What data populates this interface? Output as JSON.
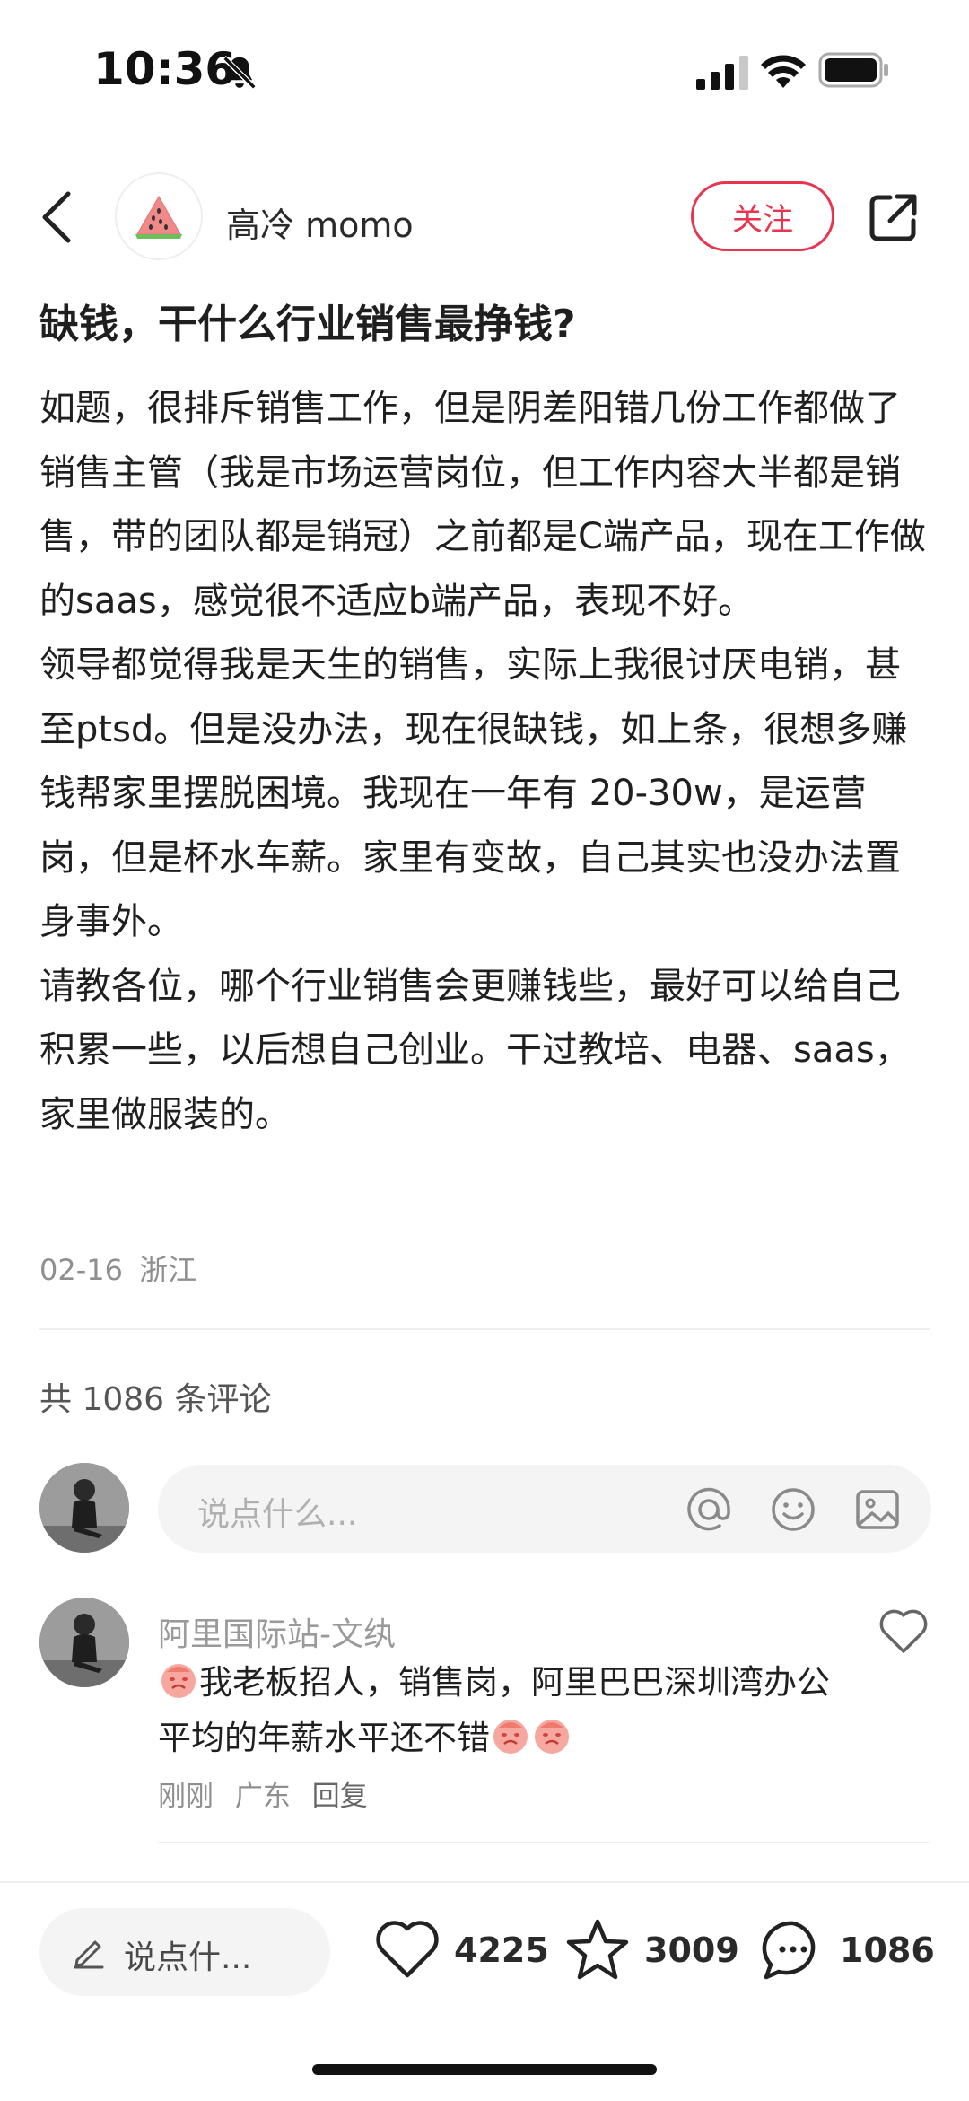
{
  "status_bar": {
    "time": "10:36"
  },
  "header": {
    "author": "高冷 momo",
    "follow_label": "关注"
  },
  "post": {
    "title": "缺钱，干什么行业销售最挣钱?",
    "paragraphs": [
      "如题，很排斥销售工作，但是阴差阳错几份工作都做了销售主管（我是市场运营岗位，但工作内容大半都是销售，带的团队都是销冠）之前都是C端产品，现在工作做的saas，感觉很不适应b端产品，表现不好。",
      "领导都觉得我是天生的销售，实际上我很讨厌电销，甚至ptsd。但是没办法，现在很缺钱，如上条，很想多赚钱帮家里摆脱困境。我现在一年有 20-30w，是运营岗，但是杯水车薪。家里有变故，自己其实也没办法置身事外。",
      "请教各位，哪个行业销售会更赚钱些，最好可以给自己积累一些，以后想自己创业。干过教培、电器、saas，家里做服装的。"
    ],
    "date": "02-16",
    "location": "浙江"
  },
  "comments_section": {
    "count_label": "共 1086 条评论",
    "input_placeholder": "说点什么...",
    "comments": [
      {
        "user": "阿里国际站-文纨",
        "text_part1": "我老板招人，销售岗，阿里巴巴深圳湾办公 平均的年薪水平还不错",
        "time": "刚刚",
        "location": "广东",
        "reply_label": "回复"
      }
    ]
  },
  "bottom_bar": {
    "input_placeholder": "说点什...",
    "likes": "4225",
    "collects": "3009",
    "comments": "1086"
  },
  "colors": {
    "accent": "#e8344e",
    "muted": "#8f8f8f"
  }
}
